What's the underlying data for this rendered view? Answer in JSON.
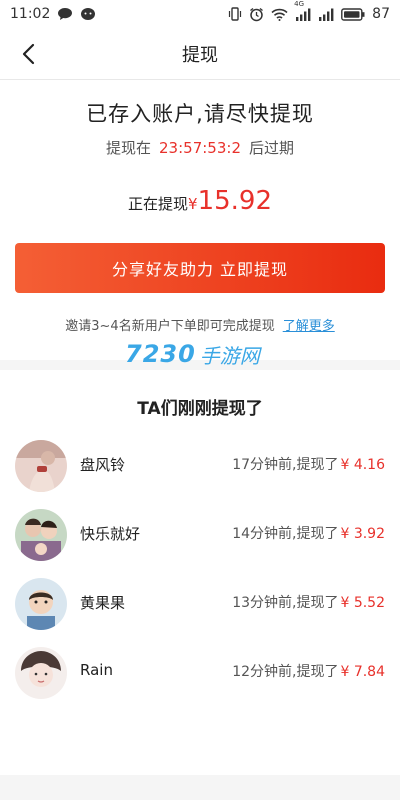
{
  "status_bar": {
    "time": "11:02",
    "battery": "87",
    "network_label": "4G",
    "icons": [
      "chat-bubble-icon",
      "wechat-icon",
      "vibrate-icon",
      "alarm-icon",
      "wifi-icon",
      "signal-icon",
      "battery-icon"
    ]
  },
  "nav": {
    "title": "提现",
    "back_icon": "back-arrow-icon"
  },
  "withdraw": {
    "headline": "已存入账户,请尽快提现",
    "expire_prefix": "提现在",
    "timer": "23:57:53:2",
    "expire_suffix": "后过期",
    "amount_label": "正在提现",
    "currency": "¥",
    "amount": "15.92",
    "button_label": "分享好友助力  立即提现",
    "tip_text": "邀请3~4名新用户下单即可完成提现",
    "tip_link": "了解更多",
    "accent_color": "#e8312b"
  },
  "watermark": {
    "number": "7230",
    "text": "手游网"
  },
  "recent": {
    "title": "TA们刚刚提现了",
    "items": [
      {
        "name": "盘风铃",
        "time": "17分钟前,提现了",
        "amount": "¥ 4.16",
        "avatar_icon": "avatar-photo-1"
      },
      {
        "name": "快乐就好",
        "time": "14分钟前,提现了",
        "amount": "¥ 3.92",
        "avatar_icon": "avatar-photo-2"
      },
      {
        "name": "黄果果",
        "time": "13分钟前,提现了",
        "amount": "¥ 5.52",
        "avatar_icon": "avatar-photo-3"
      },
      {
        "name": "Rain",
        "time": "12分钟前,提现了",
        "amount": "¥ 7.84",
        "avatar_icon": "avatar-photo-4"
      }
    ]
  }
}
